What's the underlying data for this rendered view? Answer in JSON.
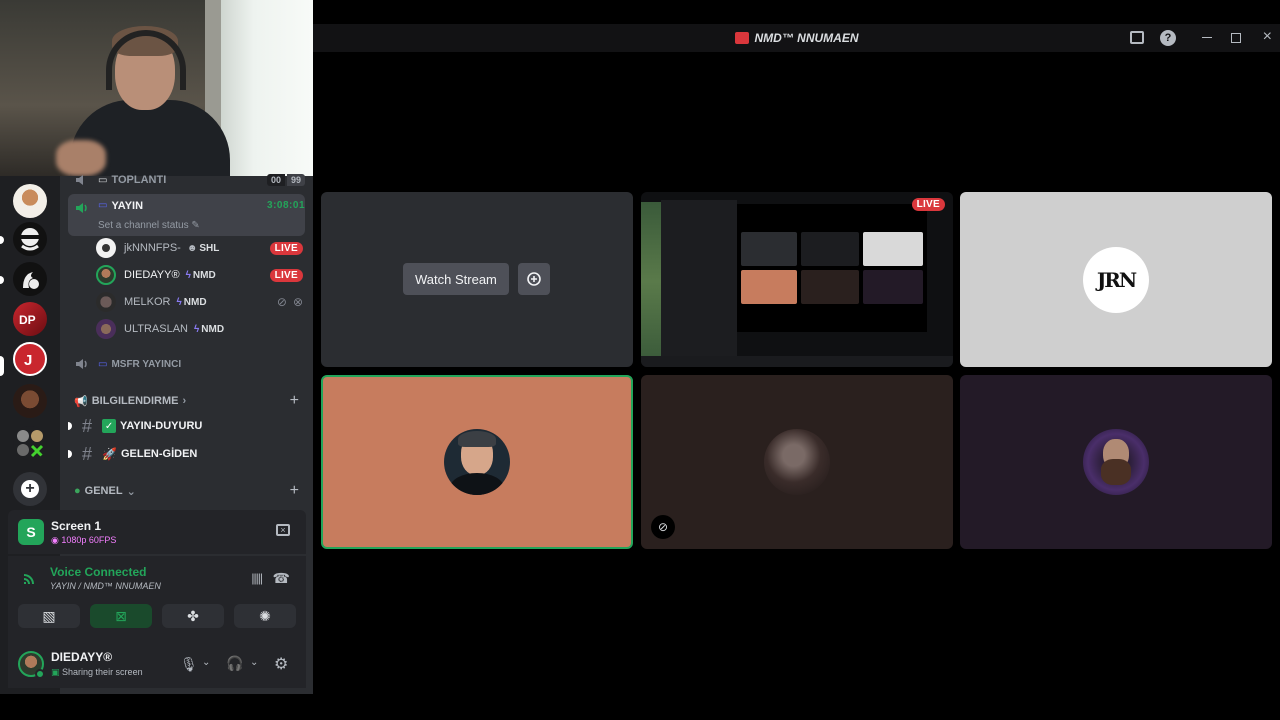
{
  "window": {
    "title": "NMD™ NNUMAEN",
    "accent": "#23a55a",
    "live_color": "#da373c"
  },
  "channels": {
    "top_channel": "TOPLANTI",
    "top_counts": [
      "00",
      "99"
    ],
    "active_channel": "YAYIN",
    "active_timer": "3:08:01",
    "status_placeholder": "Set a channel status",
    "users": [
      {
        "name": "jkNNNFPS-",
        "tag": "SHL",
        "live": "LIVE"
      },
      {
        "name": "DIEDAYY®",
        "tag": "NMD",
        "live": "LIVE"
      },
      {
        "name": "MELKOR",
        "tag": "NMD"
      },
      {
        "name": "ULTRASLAN",
        "tag": "NMD"
      }
    ],
    "second_voice": "MSFR YAYINCI",
    "category_info": "BILGILENDIRME",
    "text_channels": [
      "YAYIN-DUYURU",
      "GELEN-GİDEN"
    ],
    "category_general": "GENEL"
  },
  "screen_panel": {
    "title": "Screen 1",
    "quality": "1080p 60FPS"
  },
  "voice_panel": {
    "status": "Voice Connected",
    "channel": "YAYIN / NMD™ NNUMAEN"
  },
  "user_panel": {
    "name": "DIEDAYY®",
    "status": "Sharing their screen"
  },
  "stage": {
    "watch_label": "Watch Stream",
    "live_badge": "LIVE",
    "logo_text": "JRN"
  },
  "icons": [
    "speaker-icon",
    "hash-icon",
    "plus-icon",
    "close-icon",
    "mute-icon",
    "headphones-icon",
    "gear-icon",
    "camera-off-icon",
    "screen-share-icon",
    "activity-icon",
    "soundboard-icon",
    "disconnect-icon",
    "minimize-icon",
    "maximize-icon",
    "help-icon",
    "inbox-icon"
  ]
}
